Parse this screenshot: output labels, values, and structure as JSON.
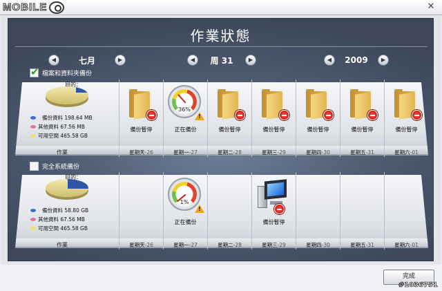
{
  "window": {
    "logo_text": "MOBILE",
    "close_label": "✕"
  },
  "header": {
    "title": "作業狀態"
  },
  "nav": {
    "month": {
      "label": "七月",
      "prev_icon": "◀",
      "next_icon": "▶"
    },
    "week": {
      "label": "周 31",
      "prev_icon": "◀",
      "next_icon": "▶"
    },
    "year": {
      "label": "2009",
      "prev_icon": "◀",
      "next_icon": "▶"
    }
  },
  "rows": [
    {
      "checkbox_label": "檔案和資料夾備份",
      "checked": true,
      "summary": {
        "target_label": "目的：",
        "backup_data": "備份資料 198.64 MB",
        "other_data": "其他資料 67.56 MB",
        "free_space": "可用空間 465.58 GB",
        "footer_label": "作業"
      },
      "cells": [
        {
          "icon": "folder-stop-icon",
          "status": "備份暫停",
          "day": "星期天",
          "date": "-26"
        },
        {
          "icon": "gauge-icon",
          "percent": "36%",
          "status": "正在備份",
          "day": "星期一",
          "date": "-27"
        },
        {
          "icon": "folder-stop-icon",
          "status": "備份暫停",
          "day": "星期二",
          "date": "-28"
        },
        {
          "icon": "folder-stop-icon",
          "status": "備份暫停",
          "day": "星期三",
          "date": "-29"
        },
        {
          "icon": "folder-stop-icon",
          "status": "備份暫停",
          "day": "星期四",
          "date": "-30"
        },
        {
          "icon": "folder-stop-icon",
          "status": "備份暫停",
          "day": "星期五",
          "date": "-31"
        },
        {
          "icon": "folder-stop-icon",
          "status": "備份暫停",
          "day": "星期六",
          "date": "-01"
        }
      ]
    },
    {
      "checkbox_label": "完全系統備份",
      "checked": false,
      "summary": {
        "target_label": "目的：",
        "backup_data": "備份資料 58.80 GB",
        "other_data": "其他資料 67.56 MB",
        "free_space": "可用空間 465.58 GB",
        "footer_label": "作業"
      },
      "cells": [
        {
          "icon": "",
          "status": "",
          "day": "星期天",
          "date": "-26"
        },
        {
          "icon": "gauge-icon",
          "percent": "1%",
          "status": "正在備份",
          "day": "星期一",
          "date": "-27"
        },
        {
          "icon": "",
          "status": "",
          "day": "星期二",
          "date": "-28"
        },
        {
          "icon": "computer-stop-icon",
          "status": "備份暫停",
          "day": "星期三",
          "date": "-29"
        },
        {
          "icon": "",
          "status": "",
          "day": "星期四",
          "date": "-30"
        },
        {
          "icon": "",
          "status": "",
          "day": "星期五",
          "date": "-31"
        },
        {
          "icon": "",
          "status": "",
          "day": "星期六",
          "date": "-01"
        }
      ]
    }
  ],
  "footer": {
    "finish_label": "完成",
    "watermark": "#1036751"
  },
  "colors": {
    "panel_bg": "#4d5a70",
    "pie_main": "#e7d889",
    "pie_slice": "#2f56a8",
    "legend_blue": "#3a6fd0",
    "legend_pink": "#e86fa0",
    "legend_yellow": "#f2e26b"
  }
}
